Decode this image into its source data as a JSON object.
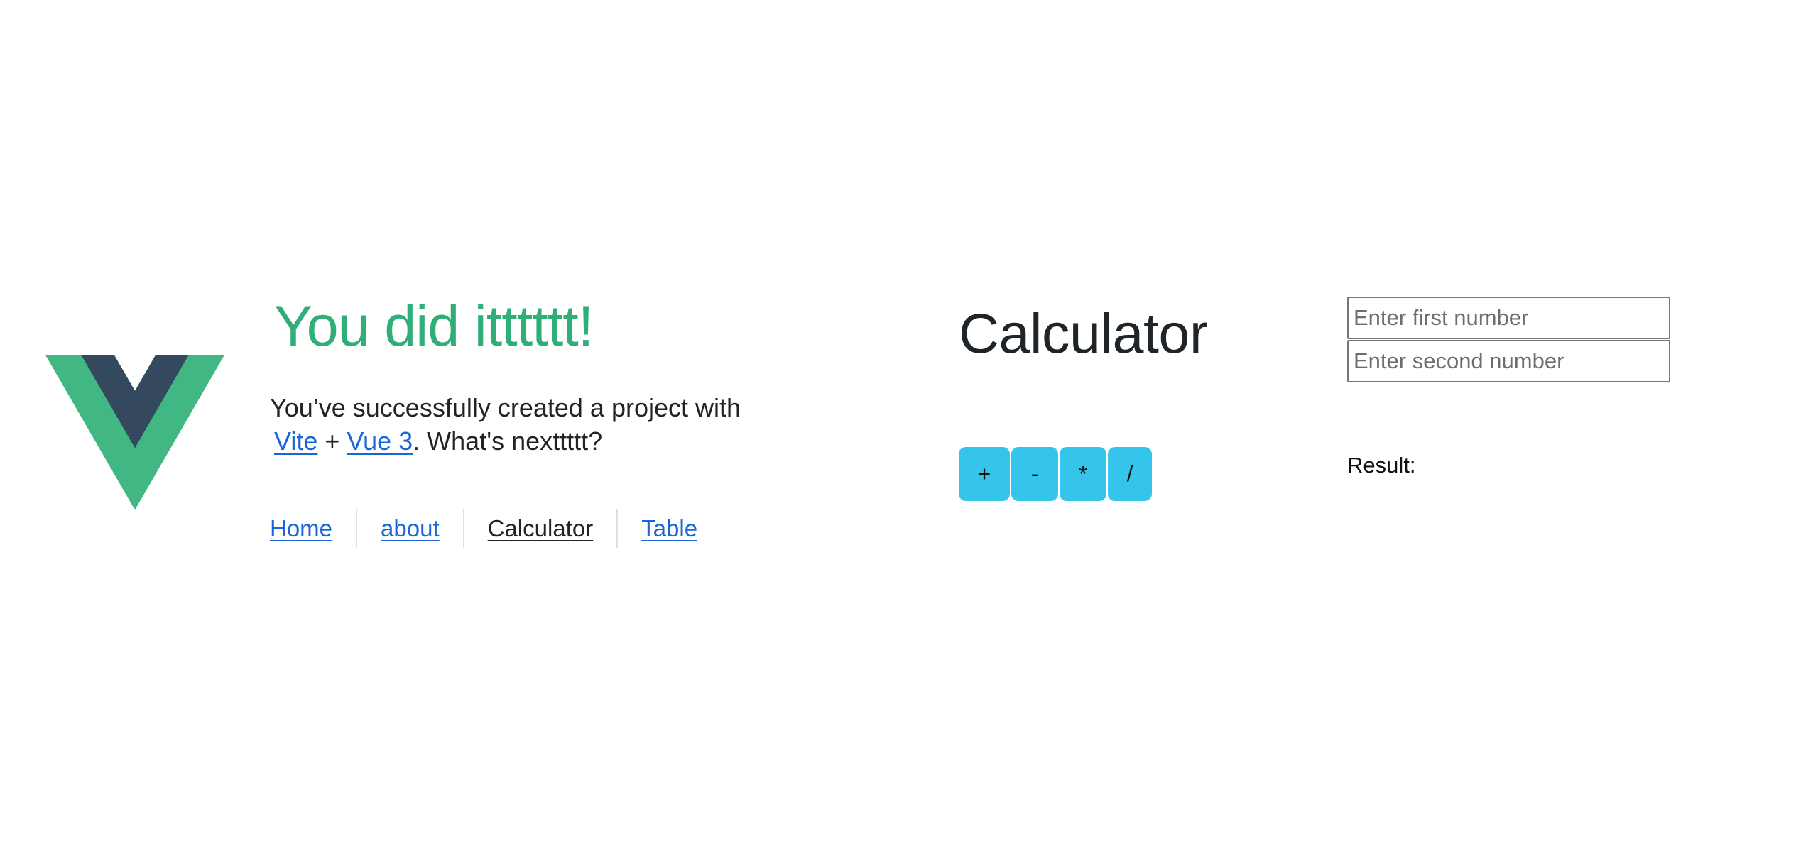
{
  "hero": {
    "title": "You did itttttt!",
    "desc_before": "You’ve successfully created a project with ",
    "link_vite": "Vite",
    "plus": " + ",
    "link_vue": "Vue 3",
    "desc_after": ". What's nexttttt?"
  },
  "nav": {
    "items": [
      {
        "label": "Home",
        "active": false
      },
      {
        "label": "about",
        "active": false
      },
      {
        "label": "Calculator",
        "active": true
      },
      {
        "label": "Table",
        "active": false
      }
    ]
  },
  "calculator": {
    "title": "Calculator",
    "first_placeholder": "Enter first number",
    "second_placeholder": "Enter second number",
    "first_value": "",
    "second_value": "",
    "operators": [
      "+",
      "-",
      "*",
      "/"
    ],
    "result_label": "Result:",
    "result_value": ""
  },
  "colors": {
    "brand_green": "#42b883",
    "brand_dark": "#35495e",
    "title_green": "#2fae78",
    "link_blue": "#1a66d6",
    "button_cyan": "#35c4ea"
  },
  "icons": {
    "logo": "vue-logo-icon"
  }
}
